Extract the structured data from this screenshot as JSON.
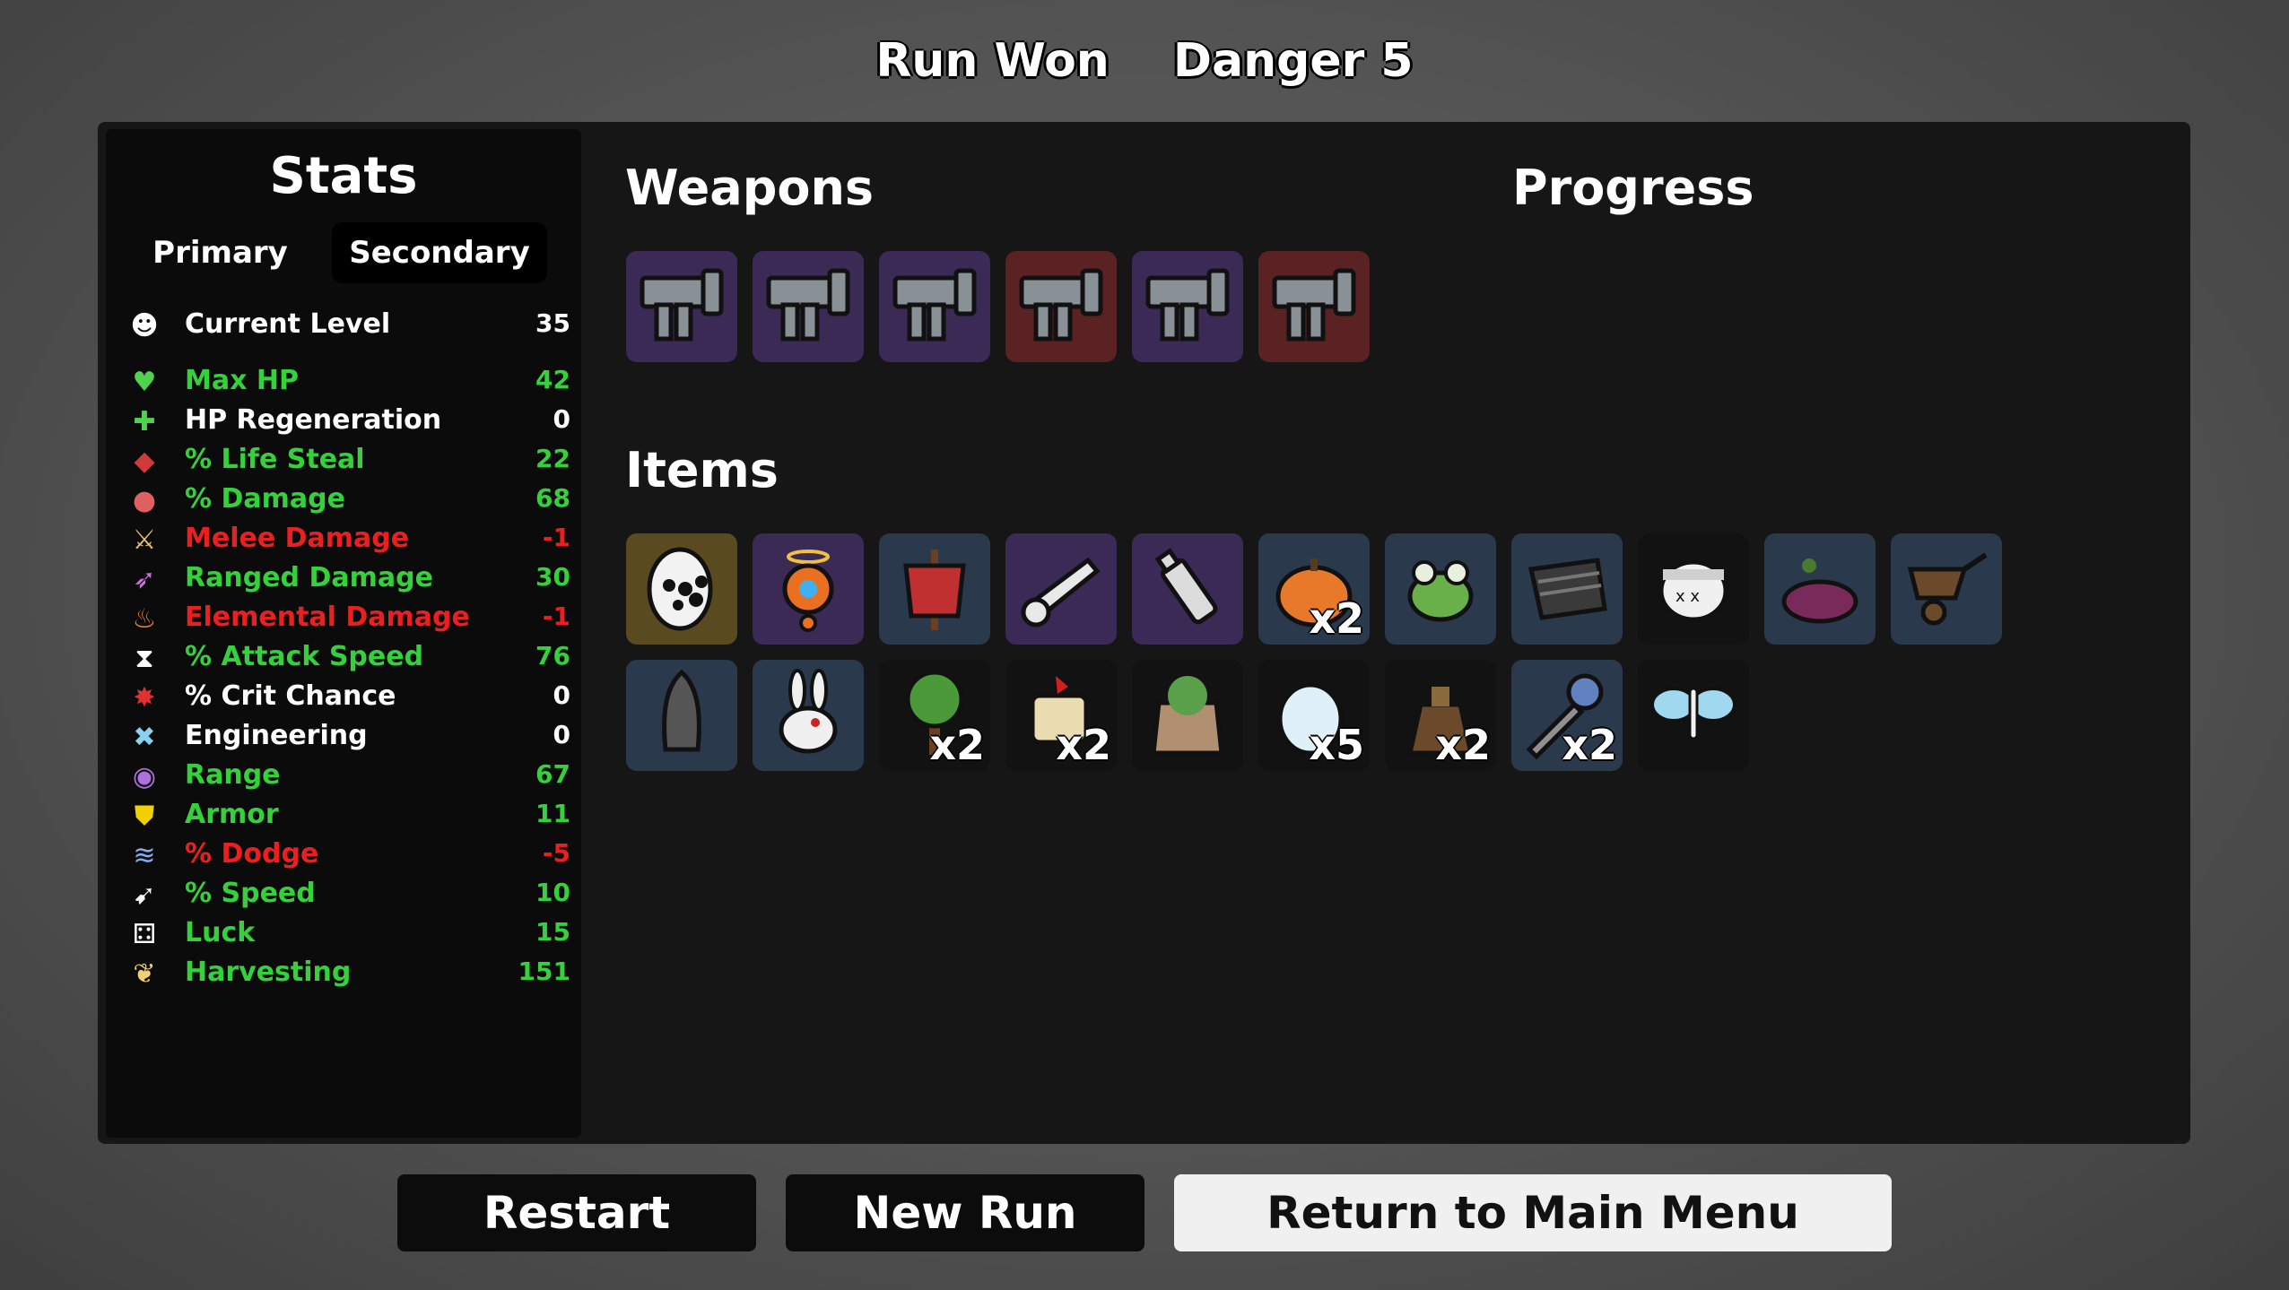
{
  "header": {
    "result": "Run Won",
    "danger": "Danger 5"
  },
  "stats": {
    "title": "Stats",
    "tabs": {
      "primary": "Primary",
      "secondary": "Secondary"
    },
    "rows": [
      {
        "label": "Current Level",
        "value": "35",
        "color": "white",
        "icon": "level-up-icon",
        "glyph": "☻",
        "glyph_color": "#ffffff"
      },
      {
        "label": "Max HP",
        "value": "42",
        "color": "green",
        "icon": "heart-icon",
        "glyph": "♥",
        "glyph_color": "#4fd34f"
      },
      {
        "label": "HP Regeneration",
        "value": "0",
        "color": "white",
        "icon": "heart-plus-icon",
        "glyph": "✚",
        "glyph_color": "#4fd34f"
      },
      {
        "label": "% Life Steal",
        "value": "22",
        "color": "green",
        "icon": "fangs-icon",
        "glyph": "◆",
        "glyph_color": "#d23a3a"
      },
      {
        "label": "% Damage",
        "value": "68",
        "color": "green",
        "icon": "muscle-icon",
        "glyph": "●",
        "glyph_color": "#e06060"
      },
      {
        "label": "Melee Damage",
        "value": "-1",
        "color": "red",
        "icon": "sword-icon",
        "glyph": "⚔",
        "glyph_color": "#e8c070"
      },
      {
        "label": "Ranged Damage",
        "value": "30",
        "color": "green",
        "icon": "bow-icon",
        "glyph": "➶",
        "glyph_color": "#d070e0"
      },
      {
        "label": "Elemental Damage",
        "value": "-1",
        "color": "red",
        "icon": "flame-icon",
        "glyph": "♨",
        "glyph_color": "#f08040"
      },
      {
        "label": "% Attack Speed",
        "value": "76",
        "color": "green",
        "icon": "hourglass-icon",
        "glyph": "⧗",
        "glyph_color": "#ffffff"
      },
      {
        "label": "% Crit Chance",
        "value": "0",
        "color": "white",
        "icon": "crit-burst-icon",
        "glyph": "✸",
        "glyph_color": "#e03030"
      },
      {
        "label": "Engineering",
        "value": "0",
        "color": "white",
        "icon": "wrench-icon",
        "glyph": "✖",
        "glyph_color": "#8ad0f0"
      },
      {
        "label": "Range",
        "value": "67",
        "color": "green",
        "icon": "wifi-icon",
        "glyph": "◉",
        "glyph_color": "#b070e0"
      },
      {
        "label": "Armor",
        "value": "11",
        "color": "green",
        "icon": "shield-icon",
        "glyph": "⛊",
        "glyph_color": "#f0d000"
      },
      {
        "label": "% Dodge",
        "value": "-5",
        "color": "red",
        "icon": "dash-icon",
        "glyph": "≋",
        "glyph_color": "#80b0f0"
      },
      {
        "label": "% Speed",
        "value": "10",
        "color": "green",
        "icon": "boot-icon",
        "glyph": "➹",
        "glyph_color": "#ffffff"
      },
      {
        "label": "Luck",
        "value": "15",
        "color": "green",
        "icon": "dice-icon",
        "glyph": "⚃",
        "glyph_color": "#ffffff"
      },
      {
        "label": "Harvesting",
        "value": "151",
        "color": "green",
        "icon": "wheat-icon",
        "glyph": "❦",
        "glyph_color": "#f0d070"
      }
    ]
  },
  "weapons": {
    "title": "Weapons",
    "items": [
      {
        "name": "pistol-icon",
        "tier": "purple"
      },
      {
        "name": "pistol-icon",
        "tier": "purple"
      },
      {
        "name": "pistol-icon",
        "tier": "purple"
      },
      {
        "name": "pistol-icon",
        "tier": "red"
      },
      {
        "name": "pistol-icon",
        "tier": "purple"
      },
      {
        "name": "pistol-icon",
        "tier": "red"
      }
    ]
  },
  "progress": {
    "title": "Progress"
  },
  "items": {
    "title": "Items",
    "rows": [
      [
        {
          "name": "spotted-egg-icon",
          "tier": "gold",
          "qty": ""
        },
        {
          "name": "angel-drone-icon",
          "tier": "purple",
          "qty": ""
        },
        {
          "name": "scarecrow-icon",
          "tier": "blue",
          "qty": ""
        },
        {
          "name": "cannon-icon",
          "tier": "purple",
          "qty": ""
        },
        {
          "name": "bottle-icon",
          "tier": "purple",
          "qty": ""
        },
        {
          "name": "pumpkin-icon",
          "tier": "blue",
          "qty": "x2"
        },
        {
          "name": "frog-icon",
          "tier": "blue",
          "qty": ""
        },
        {
          "name": "armor-plate-icon",
          "tier": "blue",
          "qty": ""
        },
        {
          "name": "bandaged-head-icon",
          "tier": "dark",
          "qty": ""
        },
        {
          "name": "meat-icon",
          "tier": "blue",
          "qty": ""
        },
        {
          "name": "wheelbarrow-icon",
          "tier": "blue",
          "qty": ""
        }
      ],
      [
        {
          "name": "bullet-icon",
          "tier": "blue",
          "qty": ""
        },
        {
          "name": "rabbit-icon",
          "tier": "blue",
          "qty": ""
        },
        {
          "name": "tree-icon",
          "tier": "dark",
          "qty": "x2"
        },
        {
          "name": "scroll-icon",
          "tier": "dark",
          "qty": "x2"
        },
        {
          "name": "seed-bag-icon",
          "tier": "dark",
          "qty": ""
        },
        {
          "name": "egg-icon",
          "tier": "dark",
          "qty": "x5"
        },
        {
          "name": "sack-icon",
          "tier": "dark",
          "qty": "x2"
        },
        {
          "name": "ice-cream-icon",
          "tier": "blue",
          "qty": "x2"
        },
        {
          "name": "butterfly-icon",
          "tier": "dark",
          "qty": ""
        }
      ]
    ]
  },
  "buttons": {
    "restart": "Restart",
    "new_run": "New Run",
    "main_menu": "Return to Main Menu"
  }
}
